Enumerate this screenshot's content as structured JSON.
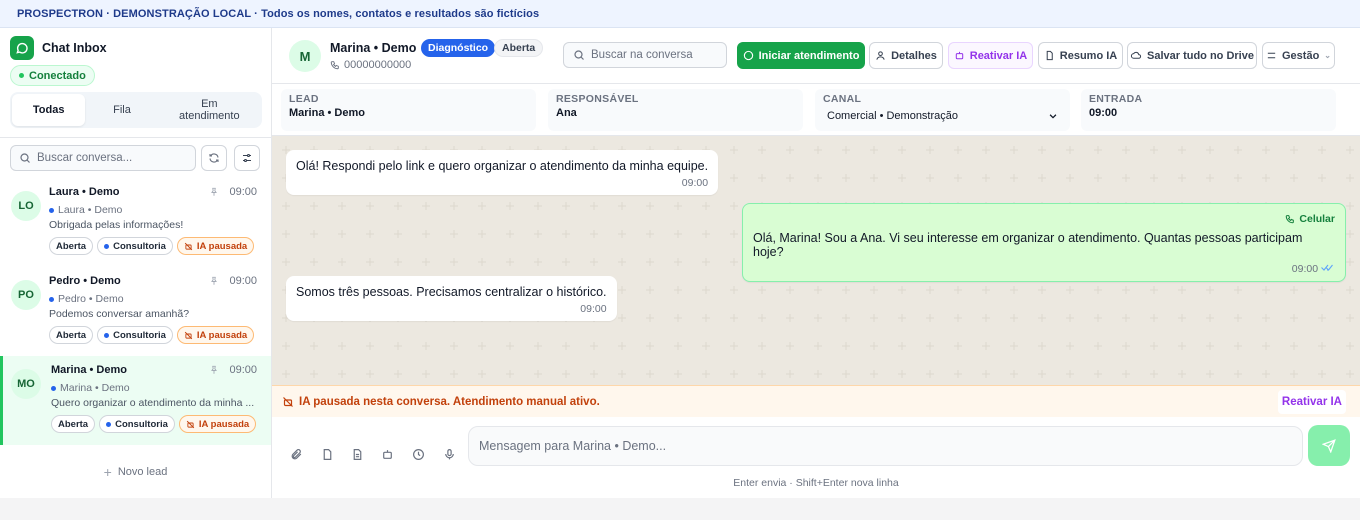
{
  "banner": {
    "text": "PROSPECTRON · DEMONSTRAÇÃO LOCAL · Todos os nomes, contatos e resultados são fictícios"
  },
  "sidebar": {
    "title": "Chat Inbox",
    "status": "Conectado",
    "tabs": [
      {
        "label": "Todas",
        "active": true
      },
      {
        "label": "Fila",
        "active": false
      },
      {
        "label": "Em atendimento",
        "active": false
      }
    ],
    "search_placeholder": "Buscar conversa...",
    "conversations": [
      {
        "initials": "LO",
        "name": "Laura • Demo",
        "time": "09:00",
        "sub": "Laura • Demo",
        "preview": "Obrigada pelas informações!",
        "tags": [
          "Aberta",
          "Consultoria",
          "IA pausada"
        ]
      },
      {
        "initials": "PO",
        "name": "Pedro • Demo",
        "time": "09:00",
        "sub": "Pedro • Demo",
        "preview": "Podemos conversar amanhã?",
        "tags": [
          "Aberta",
          "Consultoria",
          "IA pausada"
        ]
      },
      {
        "initials": "MO",
        "name": "Marina • Demo",
        "time": "09:00",
        "sub": "Marina • Demo",
        "preview": "Quero organizar o atendimento da minha ...",
        "tags": [
          "Aberta",
          "Consultoria",
          "IA pausada"
        ],
        "active": true
      }
    ],
    "new_lead": "Novo lead"
  },
  "header": {
    "avatar": "M",
    "name": "Marina • Demo",
    "badge_stage": "Diagnóstico",
    "badge_status": "Aberta",
    "phone": "00000000000",
    "search_placeholder": "Buscar na conversa",
    "buttons": {
      "start": "Iniciar atendimento",
      "details": "Detalhes",
      "reactivate": "Reativar IA",
      "summary": "Resumo IA",
      "drive": "Salvar tudo no Drive",
      "manage": "Gestão"
    }
  },
  "info": {
    "lead_label": "LEAD",
    "lead_value": "Marina • Demo",
    "owner_label": "RESPONSÁVEL",
    "owner_value": "Ana",
    "channel_label": "CANAL",
    "channel_value": "Comercial • Demonstração",
    "entry_label": "ENTRADA",
    "entry_value": "09:00"
  },
  "messages": [
    {
      "direction": "in",
      "text": "Olá! Respondi pelo link e quero organizar o atendimento da minha equipe.",
      "time": "09:00"
    },
    {
      "direction": "out",
      "tag": "Celular",
      "text": "Olá, Marina! Sou a Ana. Vi seu interesse em organizar o atendimento. Quantas pessoas participam hoje?",
      "time": "09:00"
    },
    {
      "direction": "in",
      "text": "Somos três pessoas. Precisamos centralizar o histórico.",
      "time": "09:00"
    }
  ],
  "pause_bar": {
    "text": "IA pausada nesta conversa. Atendimento manual ativo.",
    "action": "Reativar IA"
  },
  "composer": {
    "placeholder": "Mensagem para Marina • Demo...",
    "hint": "Enter envia · Shift+Enter nova linha"
  },
  "colors": {
    "accent": "#16a34a",
    "blue": "#2563eb",
    "purple": "#9333ea",
    "warning": "#c2410c",
    "chat_bg": "#ece8e0",
    "outgoing": "#d9fdd3"
  }
}
